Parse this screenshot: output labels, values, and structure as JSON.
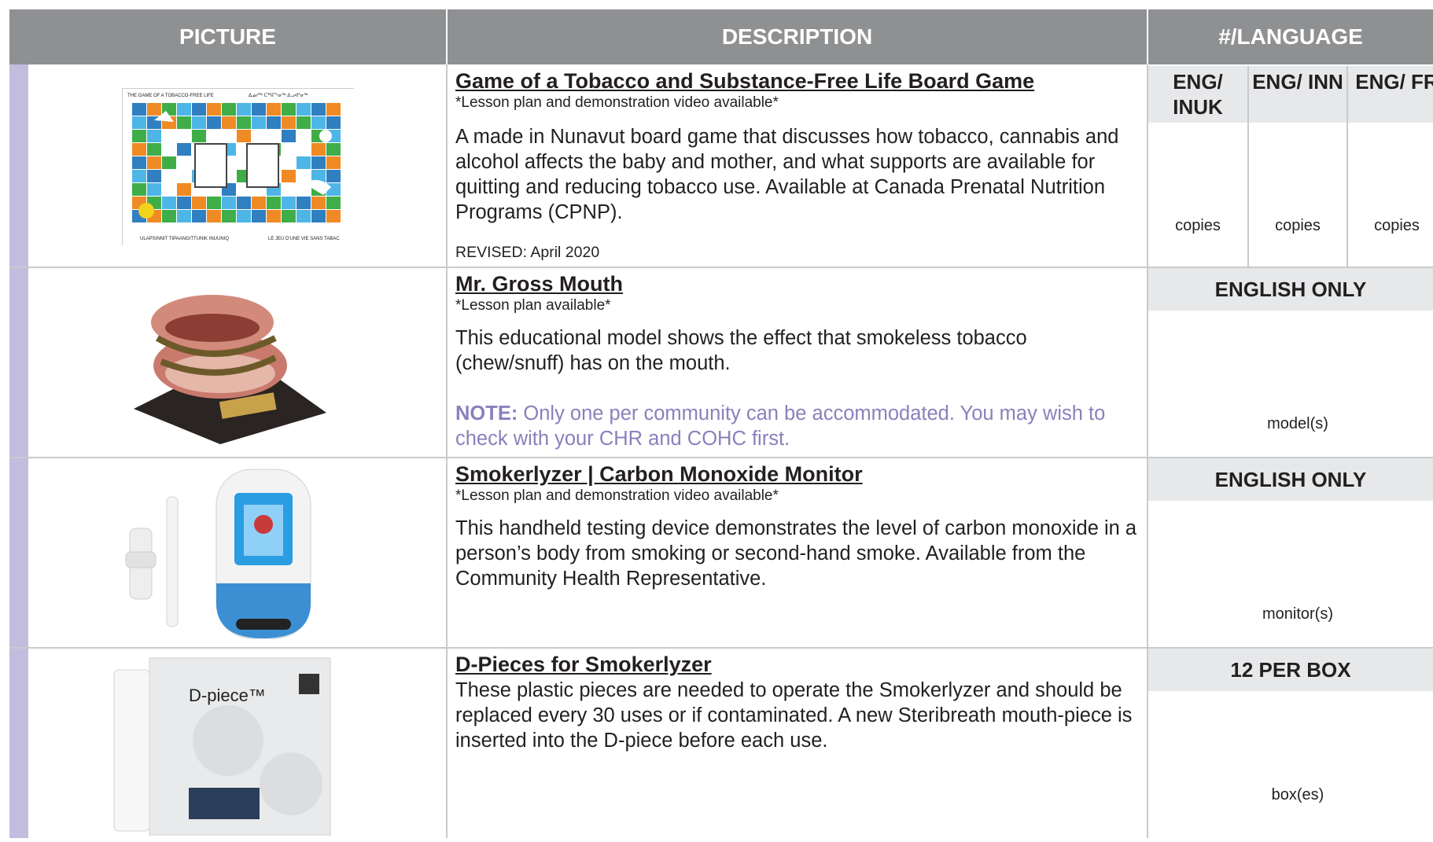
{
  "header": {
    "picture": "PICTURE",
    "description": "DESCRIPTION",
    "language": "#/LANGUAGE"
  },
  "rows": [
    {
      "title": "Game of a Tobacco and Substance-Free Life Board Game",
      "note": "*Lesson plan and demonstration video available*",
      "body": "A made in Nunavut board game that discusses how tobacco, cannabis and alcohol affects the baby and mother, and what supports are available for quitting and reducing tobacco use. Available at Canada Prenatal Nutrition Programs (CPNP).",
      "revised": "REVISED: April 2020",
      "image_text": {
        "top_left": "THE GAME OF A TOBACCO-FREE LIFE",
        "top_right": "ᐃᓅᓯᖅ ᑕᕐᕋᒥᖕᓂᖅ ᐃᓗᐊᕐᓂᖅ",
        "bottom_left": "ULAPSINNIT TIPAANGITTUNIK INUUNIQ",
        "bottom_right": "LE JEU D'UNE VIE SANS TABAC"
      },
      "languages": [
        {
          "label": "ENG/ INUK",
          "unit": "copies"
        },
        {
          "label": "ENG/ INN",
          "unit": "copies"
        },
        {
          "label": "ENG/ FR",
          "unit": "copies"
        }
      ]
    },
    {
      "title": "Mr. Gross Mouth",
      "note": "*Lesson plan available*",
      "body": "This educational model shows the effect that smokeless tobacco (chew/snuff) has on the mouth.",
      "note_label": "NOTE:",
      "note_text": " Only one per community can be accommodated. You may wish to check with your CHR and COHC first.",
      "language_label": "ENGLISH ONLY",
      "unit": "model(s)"
    },
    {
      "title": "Smokerlyzer | Carbon Monoxide Monitor",
      "note": "*Lesson plan and demonstration video available*",
      "body": "This handheld testing device demonstrates the level of carbon monoxide in a person’s body from smoking or second-hand smoke. Available from the Community Health Representative.",
      "language_label": "ENGLISH ONLY",
      "unit": "monitor(s)"
    },
    {
      "title": "D-Pieces for Smokerlyzer",
      "body": "These plastic pieces are needed to operate the Smokerlyzer and should be replaced every 30 uses or if contaminated. A new Steribreath mouth-piece is inserted into the D-piece before each use.",
      "language_label": "12 PER BOX",
      "unit": "box(es)",
      "image_text": {
        "brand": "D-piece™"
      }
    }
  ],
  "colors": {
    "header_bg": "#8f9092",
    "accent_bar": "#c2bddf",
    "note_purple": "#8a80bb",
    "cell_gray": "#e7e8e9"
  }
}
